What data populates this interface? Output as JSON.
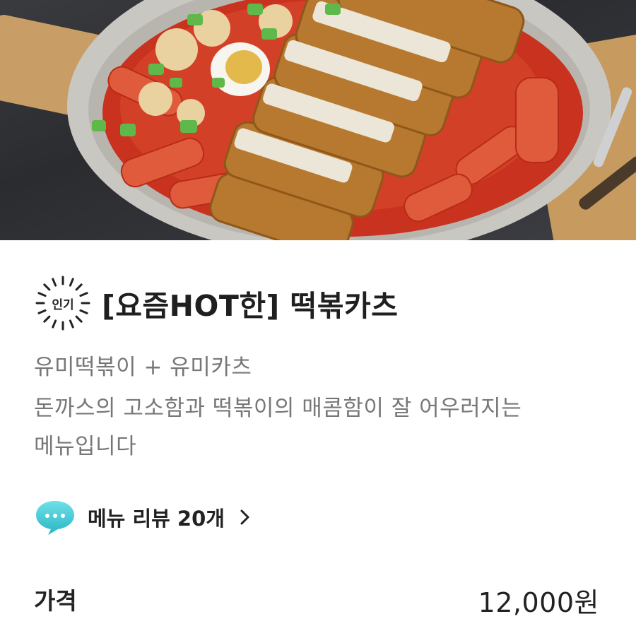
{
  "hero": {
    "image_icon": "tteokbokki-katsu-photo"
  },
  "menu": {
    "badge": "인기",
    "title": "[요즘HOT한] 떡볶카츠",
    "description": [
      "유미떡볶이 + 유미카츠",
      "돈까스의 고소함과 떡볶이의 매콤함이 잘 어우러지는",
      "메뉴입니다"
    ]
  },
  "review": {
    "icon": "chat-bubble-icon",
    "label": "메뉴 리뷰 20개"
  },
  "price": {
    "label": "가격",
    "value": "12,000원"
  },
  "colors": {
    "review_icon": "#38c6d2",
    "sauce": "#c8321f",
    "plate": "#c9c7c2"
  }
}
